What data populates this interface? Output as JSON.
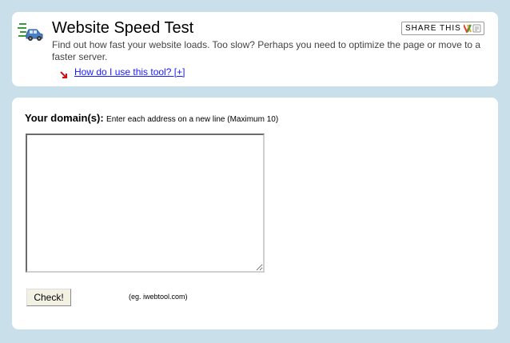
{
  "header": {
    "title": "Website Speed Test",
    "share_label": "SHARE THIS",
    "description": "Find out how fast your website loads. Too slow? Perhaps you need to optimize the page or move to a faster server.",
    "help_link": "How do I use this tool? [+]"
  },
  "form": {
    "domain_label": "Your domain(s):",
    "domain_hint": "Enter each address on a new line (Maximum 10)",
    "domains_value": "",
    "check_button": "Check!",
    "example": "(eg. iwebtool.com)"
  },
  "icons": {
    "logo": "speeding-car-icon",
    "help": "red-arrow-icon",
    "share": "share-icon"
  },
  "colors": {
    "background": "#c9dfe9",
    "link": "#1a1aff",
    "button_bg": "#f3f0e4"
  }
}
